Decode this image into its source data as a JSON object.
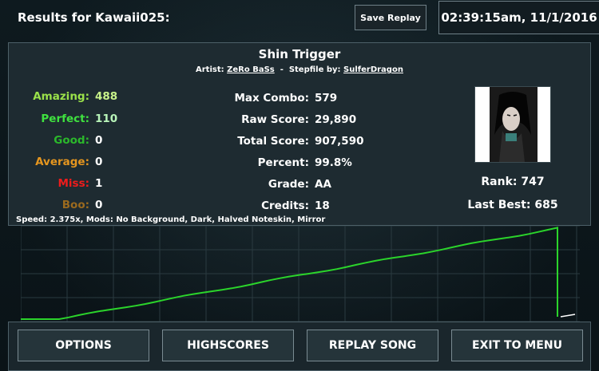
{
  "header": {
    "title": "Results for Kawaii025:",
    "save_replay_label": "Save Replay",
    "clock": "02:39:15am, 11/1/2016"
  },
  "song": {
    "title": "Shin Trigger",
    "artist_prefix": "Artist:",
    "artist": "ZeRo BaSs",
    "separator": "-",
    "stepfile_prefix": "Stepfile by:",
    "stepfile_author": "SulferDragon"
  },
  "judgements": [
    {
      "label": "Amazing:",
      "value": "488",
      "color": "#9be24a"
    },
    {
      "label": "Perfect:",
      "value": "110",
      "color": "#3fe23f"
    },
    {
      "label": "Good:",
      "value": "0",
      "color": "#2bb82b"
    },
    {
      "label": "Average:",
      "value": "0",
      "color": "#e5961f"
    },
    {
      "label": "Miss:",
      "value": "1",
      "color": "#ee1c1c"
    },
    {
      "label": "Boo:",
      "value": "0",
      "color": "#9b6a1e"
    }
  ],
  "stats": [
    {
      "label": "Max Combo:",
      "value": "579"
    },
    {
      "label": "Raw Score:",
      "value": "29,890"
    },
    {
      "label": "Total Score:",
      "value": "907,590"
    },
    {
      "label": "Percent:",
      "value": "99.8%"
    },
    {
      "label": "Grade:",
      "value": "AA"
    },
    {
      "label": "Credits:",
      "value": "18"
    }
  ],
  "player": {
    "rank": "Rank: 747",
    "last_best": "Last Best: 685"
  },
  "speed_line": "Speed: 2.375x, Mods: No Background, Dark, Halved Noteskin, Mirror",
  "graph": {
    "line_color": "#2bd42b",
    "grid_color": "#2a3a40"
  },
  "footer": {
    "options": "OPTIONS",
    "highscores": "HIGHSCORES",
    "replay": "REPLAY SONG",
    "exit": "EXIT TO MENU"
  }
}
